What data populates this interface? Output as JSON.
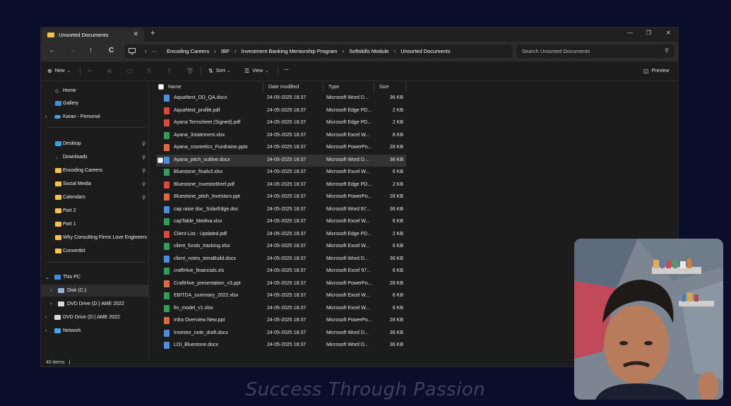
{
  "window": {
    "tab_title": "Unsorted Documents",
    "tab_close": "✕",
    "new_tab": "+",
    "controls": {
      "minimize": "—",
      "maximize": "❐",
      "close": "✕"
    }
  },
  "nav": {
    "back": "←",
    "forward": "→",
    "up": "↑",
    "refresh": "C",
    "breadcrumb": [
      "Encoding Careers",
      "IBP",
      "Investment Banking Mentorship Program",
      "Softskills Module",
      "Unsorted Documents"
    ],
    "ellipsis": "···",
    "search_placeholder": "Search Unsorted Documents"
  },
  "toolbar": {
    "new_label": "New",
    "sort_label": "Sort",
    "view_label": "View",
    "more_label": "···",
    "preview_label": "Preview"
  },
  "sidebar": {
    "home": "Home",
    "gallery": "Gallery",
    "onedrive": "Karan - Personal",
    "quick": [
      "Desktop",
      "Downloads",
      "Encoding Careers",
      "Social Media",
      "Calendars",
      "Part 2",
      "Part 1",
      "Why Consulting Firms Love Engineers",
      "Convertkit"
    ],
    "this_pc": "This PC",
    "disk": "Disk (C:)",
    "dvd1": "DVD Drive (D:) AME 2022",
    "dvd2": "DVD Drive (D:) AME 2022",
    "network": "Network"
  },
  "columns": {
    "name": "Name",
    "date": "Date modified",
    "type": "Type",
    "size": "Size"
  },
  "files": [
    {
      "name": "AquaNest_DD_QA.docx",
      "date": "24-05-2025 18:37",
      "type": "Microsoft Word D...",
      "size": "36 KB",
      "kind": "word"
    },
    {
      "name": "AquaNest_profile.pdf",
      "date": "24-05-2025 18:37",
      "type": "Microsoft Edge PD...",
      "size": "2 KB",
      "kind": "pdf"
    },
    {
      "name": "Ayana Termsheet (Signed).pdf",
      "date": "24-05-2025 18:37",
      "type": "Microsoft Edge PD...",
      "size": "2 KB",
      "kind": "pdf"
    },
    {
      "name": "Ayana_3statement.xlsx",
      "date": "24-05-2025 18:37",
      "type": "Microsoft Excel W...",
      "size": "6 KB",
      "kind": "excel"
    },
    {
      "name": "Ayana_cosmetics_Fundraise.pptx",
      "date": "24-05-2025 18:37",
      "type": "Microsoft PowerPo...",
      "size": "28 KB",
      "kind": "ppt"
    },
    {
      "name": "Ayana_pitch_outline.docx",
      "date": "24-05-2025 18:37",
      "type": "Microsoft Word D...",
      "size": "36 KB",
      "kind": "word"
    },
    {
      "name": "Bluestone_finalv3.xlsx",
      "date": "24-05-2025 18:37",
      "type": "Microsoft Excel W...",
      "size": "6 KB",
      "kind": "excel"
    },
    {
      "name": "Bluestone_InvestorBrief.pdf",
      "date": "24-05-2025 18:37",
      "type": "Microsoft Edge PD...",
      "size": "2 KB",
      "kind": "pdf"
    },
    {
      "name": "Bluestone_pitch_Investors.ppt",
      "date": "24-05-2025 18:37",
      "type": "Microsoft PowerPo...",
      "size": "28 KB",
      "kind": "ppt"
    },
    {
      "name": "cap raise doc_SolarEdge.doc",
      "date": "24-05-2025 18:37",
      "type": "Microsoft Word 97...",
      "size": "36 KB",
      "kind": "word"
    },
    {
      "name": "capTable_Mediva.xlsx",
      "date": "24-05-2025 18:37",
      "type": "Microsoft Excel W...",
      "size": "6 KB",
      "kind": "excel"
    },
    {
      "name": "Client List - Updated.pdf",
      "date": "24-05-2025 18:37",
      "type": "Microsoft Edge PD...",
      "size": "2 KB",
      "kind": "pdf"
    },
    {
      "name": "client_funds_tracking.xlsx",
      "date": "24-05-2025 18:37",
      "type": "Microsoft Excel W...",
      "size": "6 KB",
      "kind": "excel"
    },
    {
      "name": "client_notes_terraBuild.docx",
      "date": "24-05-2025 18:37",
      "type": "Microsoft Word D...",
      "size": "36 KB",
      "kind": "word"
    },
    {
      "name": "craftHive_financials.xls",
      "date": "24-05-2025 18:37",
      "type": "Microsoft Excel 97...",
      "size": "6 KB",
      "kind": "excel"
    },
    {
      "name": "CraftHive_presentation_v3.ppt",
      "date": "24-05-2025 18:37",
      "type": "Microsoft PowerPo...",
      "size": "28 KB",
      "kind": "ppt"
    },
    {
      "name": "EBITDA_summary_2022.xlsx",
      "date": "24-05-2025 18:37",
      "type": "Microsoft Excel W...",
      "size": "6 KB",
      "kind": "excel"
    },
    {
      "name": "fin_model_v1.xlsx",
      "date": "24-05-2025 18:37",
      "type": "Microsoft Excel W...",
      "size": "6 KB",
      "kind": "excel"
    },
    {
      "name": "Infra Overview New.ppt",
      "date": "24-05-2025 18:37",
      "type": "Microsoft PowerPo...",
      "size": "28 KB",
      "kind": "ppt"
    },
    {
      "name": "Investor_note_draft.docx",
      "date": "24-05-2025 18:37",
      "type": "Microsoft Word D...",
      "size": "36 KB",
      "kind": "word"
    },
    {
      "name": "LOI_Bluestone.docx",
      "date": "24-05-2025 18:37",
      "type": "Microsoft Word D...",
      "size": "36 KB",
      "kind": "word"
    }
  ],
  "hovered_row": 5,
  "status": {
    "count": "40 items",
    "sep": "|"
  },
  "caption": "Success Through Passion",
  "colors": {
    "word": "#4a8fe0",
    "pdf": "#e0463c",
    "excel": "#2f9e5a",
    "ppt": "#e2673a",
    "folder": "#f2c14e"
  }
}
